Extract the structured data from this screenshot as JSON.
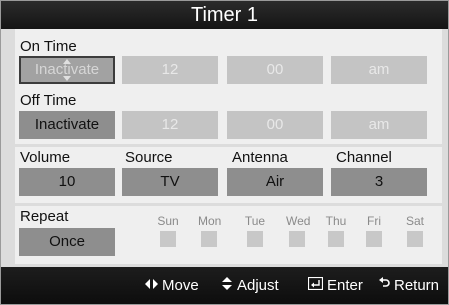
{
  "title": "Timer 1",
  "on_time": {
    "label": "On Time",
    "mode": "Inactivate",
    "hour": "12",
    "minute": "00",
    "ampm": "am"
  },
  "off_time": {
    "label": "Off Time",
    "mode": "Inactivate",
    "hour": "12",
    "minute": "00",
    "ampm": "am"
  },
  "settings": {
    "volume": {
      "label": "Volume",
      "value": "10"
    },
    "source": {
      "label": "Source",
      "value": "TV"
    },
    "antenna": {
      "label": "Antenna",
      "value": "Air"
    },
    "channel": {
      "label": "Channel",
      "value": "3"
    }
  },
  "repeat": {
    "label": "Repeat",
    "value": "Once",
    "days": [
      "Sun",
      "Mon",
      "Tue",
      "Wed",
      "Thu",
      "Fri",
      "Sat"
    ]
  },
  "footer": {
    "move": {
      "icon": "left-right-arrows-icon",
      "label": "Move"
    },
    "adjust": {
      "icon": "up-down-arrows-icon",
      "label": "Adjust"
    },
    "enter": {
      "icon": "enter-icon",
      "label": "Enter"
    },
    "return": {
      "icon": "return-icon",
      "label": "Return"
    }
  },
  "colors": {
    "selected_border": "#3c3c3c",
    "active_field": "#8e8e8e",
    "disabled_field": "#c4c4c4",
    "bar": "#151515"
  }
}
